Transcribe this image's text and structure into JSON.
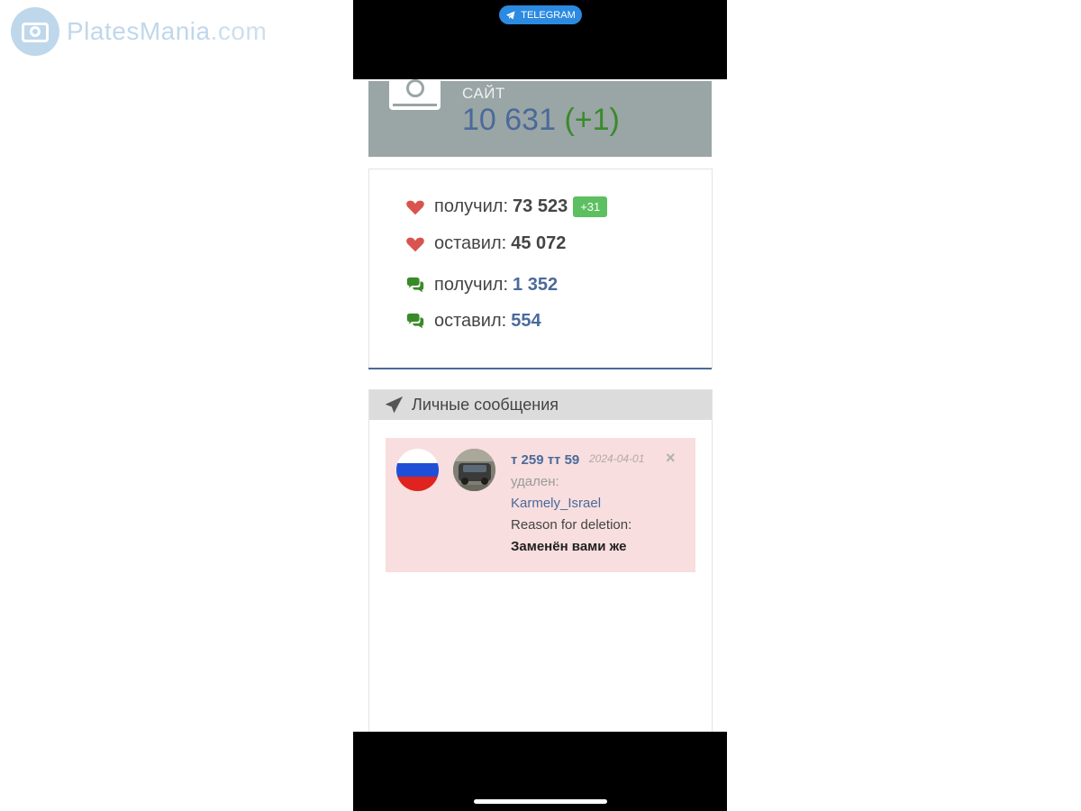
{
  "watermark": {
    "brand_part1": "PlatesMania",
    "brand_part2": ".com"
  },
  "status_bar": {
    "telegram_label": "TELEGRAM"
  },
  "site_card": {
    "label": "САЙТ",
    "count": "10 631",
    "delta": "(+1)"
  },
  "stats": [
    {
      "icon": "heart-icon",
      "label": "получил:",
      "value": "73 523",
      "badge": "+31",
      "value_style": "dark"
    },
    {
      "icon": "heart-icon",
      "label": "оставил:",
      "value": "45 072",
      "badge": null,
      "value_style": "dark"
    },
    {
      "icon": "comments-icon",
      "label": "получил:",
      "value": "1 352",
      "badge": null,
      "value_style": "blue"
    },
    {
      "icon": "comments-icon",
      "label": "оставил:",
      "value": "554",
      "badge": null,
      "value_style": "blue"
    }
  ],
  "messages": {
    "title": "Личные сообщения",
    "items": [
      {
        "plate": "т 259 тт 59",
        "date": "2024-04-01",
        "status": "удален:",
        "user": "Karmely_Israel",
        "reason_label": "Reason for deletion:",
        "reason": "Заменён вами же",
        "close": "×"
      }
    ]
  },
  "colors": {
    "accent_blue": "#4a6a9a",
    "delta_green": "#3a8a2a",
    "badge_green": "#5cbf60",
    "heart_red": "#d9534f",
    "comment_green": "#3a8a2a",
    "message_bg": "#f8dede"
  }
}
